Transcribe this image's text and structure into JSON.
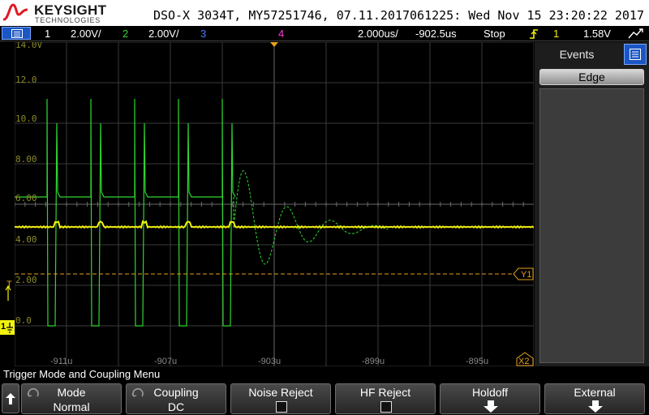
{
  "header": {
    "brand": "KEYSIGHT",
    "brand_sub": "TECHNOLOGIES",
    "title": "DSO-X 3034T, MY57251746, 07.11.2017061225: Wed Nov 15 23:20:22 2017"
  },
  "status_bar": {
    "ch1_label": "1",
    "ch1_scale": "2.00V/",
    "ch2_label": "2",
    "ch2_scale": "2.00V/",
    "ch3_label": "3",
    "ch4_label": "4",
    "timebase": "2.000us/",
    "delay": "-902.5us",
    "run_state": "Stop",
    "trigger_source": "1",
    "trigger_level": "1.58V",
    "colors": {
      "ch1": "#f1f10f",
      "ch2": "#2fd62f",
      "ch3": "#4a78ff",
      "ch4": "#ff3ad3",
      "trigger": "#f1f10f"
    }
  },
  "waveform": {
    "y_labels": [
      "14.0V",
      "12.0",
      "10.0",
      "8.00",
      "6.00",
      "4.00",
      "2.00",
      "0.0"
    ],
    "x_labels": [
      "-911u",
      "-907u",
      "-903u",
      "-899u",
      "-895u"
    ],
    "cursor_y1_label": "Y1",
    "cursor_x2_label": "X2",
    "trigger_marker_label": "T",
    "ground_marker_label": "1"
  },
  "side_panel": {
    "tab_label": "Events",
    "edge_button_label": "Edge"
  },
  "menu": {
    "title": "Trigger Mode and Coupling Menu",
    "softkeys": [
      {
        "title": "Mode",
        "value": "Normal"
      },
      {
        "title": "Coupling",
        "value": "DC"
      },
      {
        "title": "Noise Reject",
        "value": ""
      },
      {
        "title": "HF Reject",
        "value": ""
      },
      {
        "title": "Holdoff",
        "value": ""
      },
      {
        "title": "External",
        "value": ""
      }
    ]
  }
}
